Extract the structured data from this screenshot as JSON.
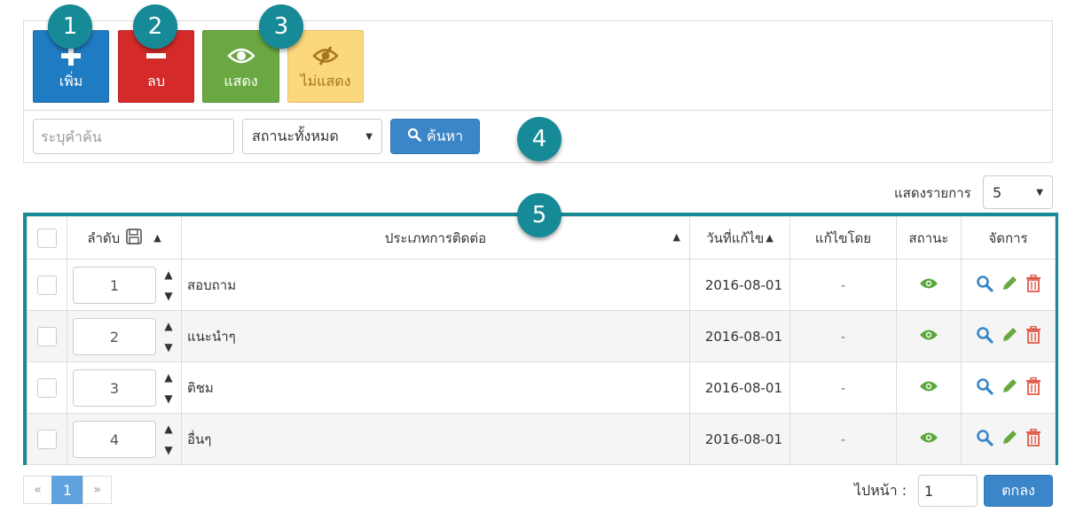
{
  "toolbar": {
    "add_label": "เพิ่ม",
    "delete_label": "ลบ",
    "show_label": "แสดง",
    "hide_label": "ไม่แสดง"
  },
  "search": {
    "placeholder": "ระบุคำค้น",
    "status_selected": "สถานะทั้งหมด",
    "search_label": "ค้นหา"
  },
  "callouts": [
    "1",
    "2",
    "3",
    "4",
    "5"
  ],
  "show_rows": {
    "label": "แสดงรายการ",
    "value": "5"
  },
  "table": {
    "headers": {
      "order": "ลำดับ",
      "type": "ประเภทการติดต่อ",
      "date": "วันที่แก้ไข",
      "edited_by": "แก้ไขโดย",
      "status": "สถานะ",
      "manage": "จัดการ"
    },
    "rows": [
      {
        "order": "1",
        "type": "สอบถาม",
        "date": "2016-08-01",
        "edited_by": "-"
      },
      {
        "order": "2",
        "type": "แนะนำๆ",
        "date": "2016-08-01",
        "edited_by": "-"
      },
      {
        "order": "3",
        "type": "ติชม",
        "date": "2016-08-01",
        "edited_by": "-"
      },
      {
        "order": "4",
        "type": "อื่นๆ",
        "date": "2016-08-01",
        "edited_by": "-"
      }
    ]
  },
  "pagination": {
    "prev": "«",
    "current": "1",
    "next": "»"
  },
  "goto": {
    "label": "ไปหน้า :",
    "value": "1",
    "button": "ตกลง"
  },
  "colors": {
    "add": "#1f7bc2",
    "delete": "#d42a2a",
    "show": "#6aa842",
    "hide": "#fbd77e",
    "callout": "#178a97",
    "primary": "#3a86c8",
    "status_icon": "#5aa83a",
    "edit_icon": "#6aa842",
    "trash_icon": "#e05a4a",
    "view_icon": "#3a86c8"
  }
}
